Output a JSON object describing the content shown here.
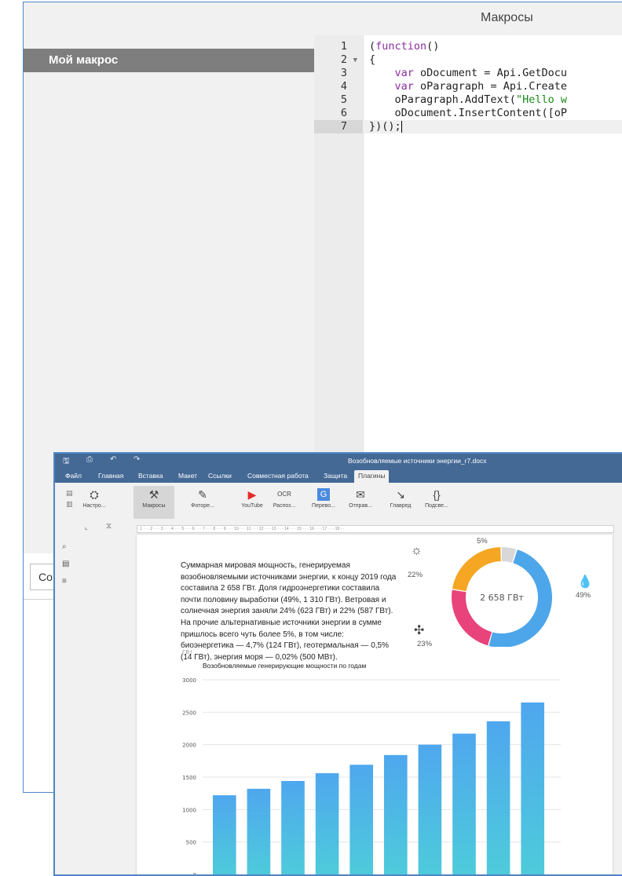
{
  "macros_dialog": {
    "title": "Макросы",
    "macro_list": [
      "Мой макрос"
    ],
    "code_lines": [
      {
        "num": "1",
        "fold": "",
        "text": "(function()"
      },
      {
        "num": "2",
        "fold": "▼",
        "text": "{"
      },
      {
        "num": "3",
        "fold": "",
        "text": "    var oDocument = Api.GetDocu"
      },
      {
        "num": "4",
        "fold": "",
        "text": "    var oParagraph = Api.Create"
      },
      {
        "num": "5",
        "fold": "",
        "text": "    oParagraph.AddText(\"Hello w"
      },
      {
        "num": "6",
        "fold": "",
        "text": "    oDocument.InsertContent([oP"
      },
      {
        "num": "7",
        "fold": "",
        "text": "})();"
      }
    ],
    "name_input_value": "Co"
  },
  "editor": {
    "doc_title": "Возобновляемые источники энергии_r7.docx",
    "title_icons": [
      "save-icon",
      "print-icon",
      "undo-icon",
      "redo-icon"
    ],
    "tabs": [
      "Файл",
      "Главная",
      "Вставка",
      "Макет",
      "Ссылки",
      "Совместная работа",
      "Защита",
      "Плагины"
    ],
    "active_tab": "Плагины",
    "toolbar": [
      {
        "name": "settings",
        "icon": "⛭",
        "label": "Настро..."
      },
      {
        "name": "macros",
        "icon": "⚒",
        "label": "Макросы"
      },
      {
        "name": "photo-editor",
        "icon": "✎",
        "label": "Фоторе..."
      },
      {
        "name": "youtube",
        "icon": "▶",
        "label": "YouTube"
      },
      {
        "name": "ocr",
        "icon": "OCR",
        "label": "Распоз..."
      },
      {
        "name": "translate",
        "icon": "G",
        "label": "Перево..."
      },
      {
        "name": "send",
        "icon": "✉",
        "label": "Отправ..."
      },
      {
        "name": "glavred",
        "icon": "↘",
        "label": "Главред"
      },
      {
        "name": "highlight",
        "icon": "{}",
        "label": "Подсве..."
      }
    ],
    "ruler_text": "· 1 · · · 2 · · · 3 · · · 4 · · · 5 · · · 6 · · · 7 · · · 8 · · · 9 · · · 10 · · · 11 · · · 12 · · · 13 · · · 14 · · · 15 · · · 16 · · · 17 · · · 18 · ·",
    "paragraph": "Суммарная мировая мощность, генерируемая возобновляемыми источниками энергии, к концу 2019 года составила 2 658 ГВт.  Доля гидроэнергетики составила почти половину выработки (49%, 1 310 ГВт). Ветровая и солнечная энергия заняли 24% (623 ГВт) и 22% (587 ГВт). На прочие альтернативные источники энергии в сумме пришлось всего чуть более 5%, в том числе: биоэнергетика — 4,7% (124 ГВт), геотермальная — 0,5% (14 ГВт), энергия моря — 0,02% (500 МВт)."
  },
  "chart_data": [
    {
      "type": "pie",
      "center_label": "2 658 ГВт",
      "labels": [
        "49%",
        "23%",
        "22%",
        "5%"
      ],
      "values": [
        49,
        23,
        22,
        5
      ],
      "colors": [
        "#4da6ea",
        "#e8437a",
        "#f5a623",
        "#d8d8d8"
      ],
      "icons": [
        "hydro-icon",
        "wind-icon",
        "solar-icon",
        "other-icon"
      ]
    },
    {
      "type": "bar",
      "title": "Возобновляемые генерирующие мощности по годам",
      "ylabel": "ГВт",
      "ylim": [
        0,
        3000
      ],
      "yticks": [
        0,
        500,
        1000,
        1500,
        2000,
        2500,
        3000
      ],
      "values": [
        1220,
        1320,
        1440,
        1560,
        1690,
        1840,
        2000,
        2170,
        2360,
        2650
      ],
      "bar_top_color": "#4fa7ee",
      "bar_bottom_color": "#4ecbdb"
    }
  ]
}
